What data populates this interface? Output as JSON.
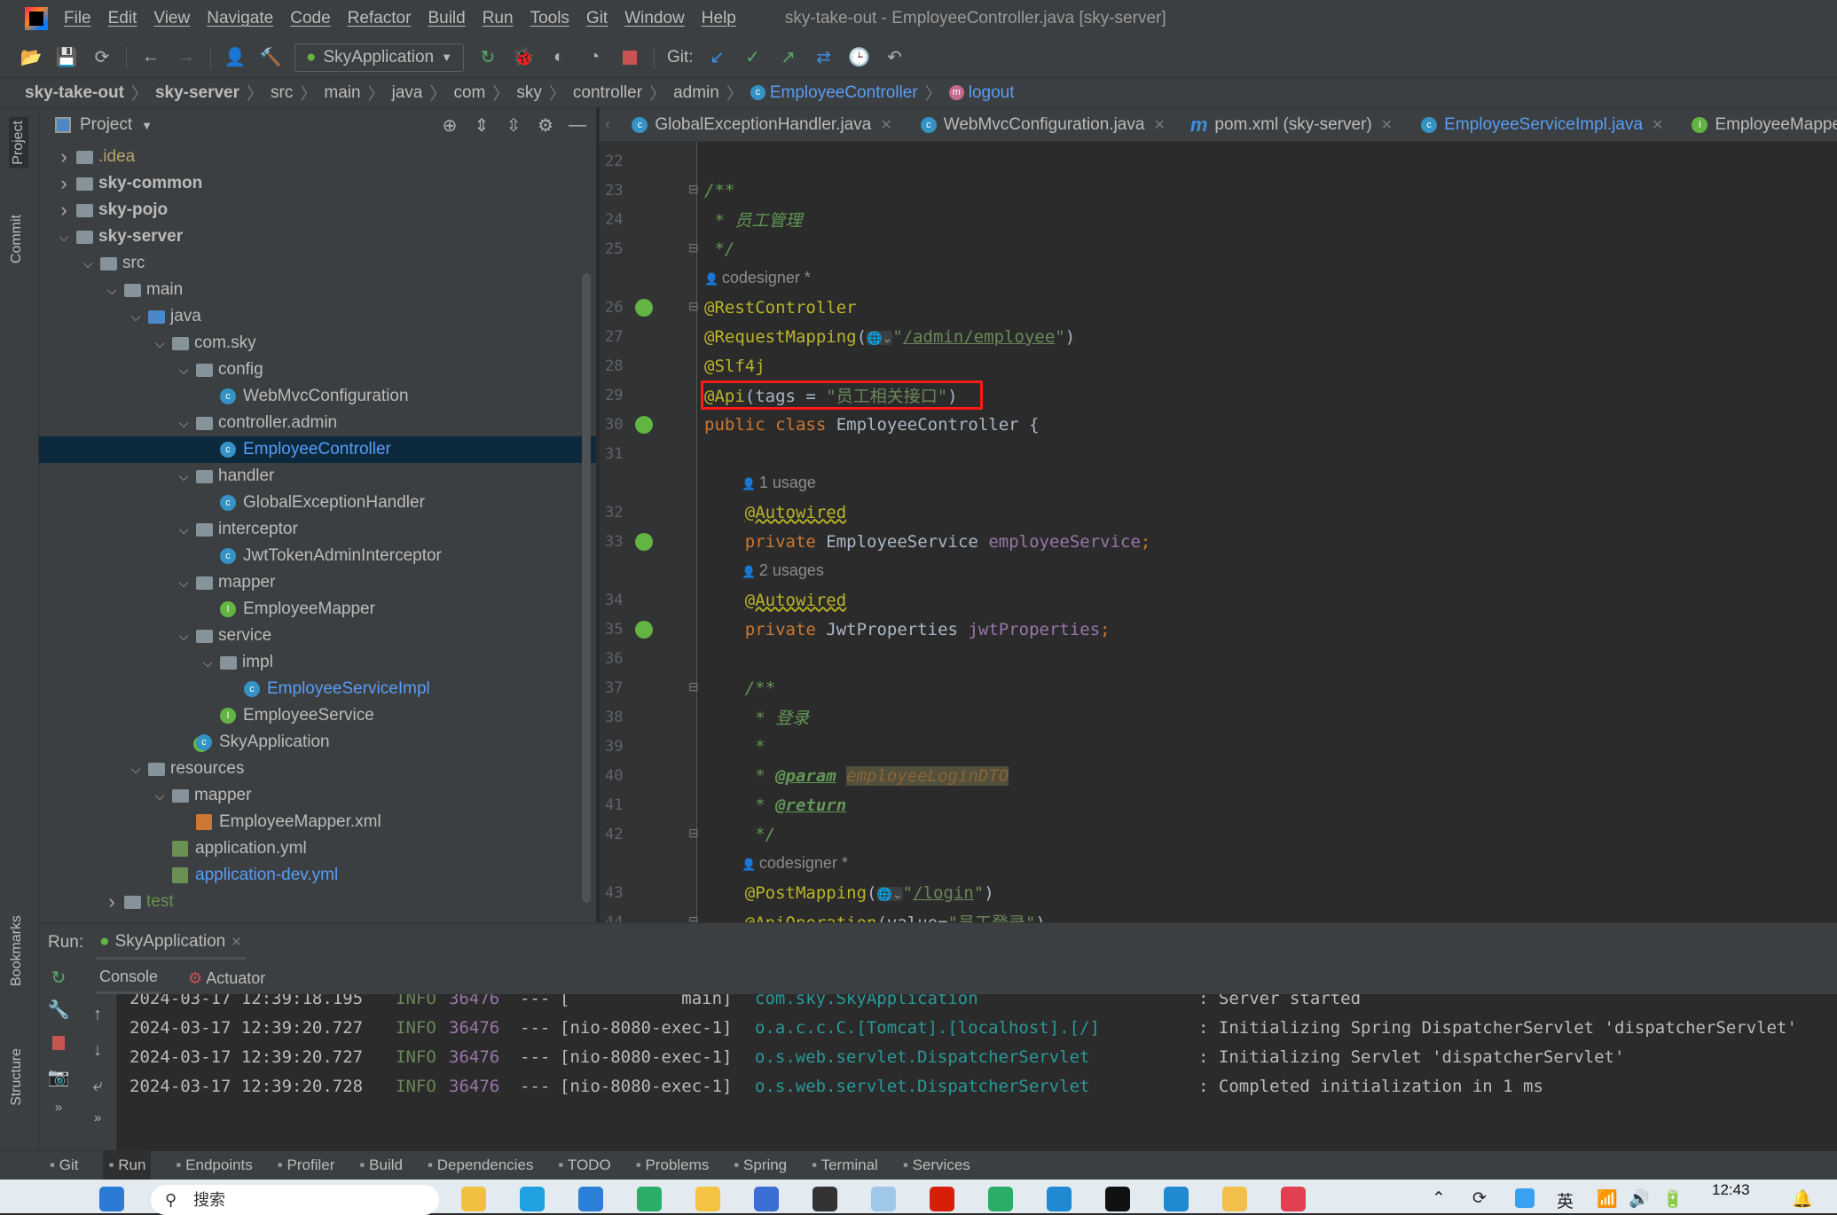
{
  "menu": [
    "File",
    "Edit",
    "View",
    "Navigate",
    "Code",
    "Refactor",
    "Build",
    "Run",
    "Tools",
    "Git",
    "Window",
    "Help"
  ],
  "window_title": "sky-take-out - EmployeeController.java [sky-server]",
  "toolbar": {
    "run_config": "SkyApplication",
    "git_label": "Git:"
  },
  "breadcrumb": [
    {
      "label": "sky-take-out",
      "bold": true
    },
    {
      "label": "sky-server",
      "bold": true
    },
    {
      "label": "src"
    },
    {
      "label": "main"
    },
    {
      "label": "java"
    },
    {
      "label": "com"
    },
    {
      "label": "sky"
    },
    {
      "label": "controller"
    },
    {
      "label": "admin"
    },
    {
      "label": "EmployeeController",
      "icon": "class"
    },
    {
      "label": "logout",
      "icon": "method"
    }
  ],
  "left_strip": {
    "project": "Project",
    "commit": "Commit",
    "bookmarks": "Bookmarks",
    "structure": "Structure"
  },
  "project_panel": {
    "title": "Project",
    "tree": [
      {
        "level": 0,
        "label": ".idea",
        "type": "folder",
        "state": "collapsed",
        "color": "#b8a36a"
      },
      {
        "level": 0,
        "label": "sky-common",
        "type": "module",
        "state": "collapsed",
        "bold": true
      },
      {
        "level": 0,
        "label": "sky-pojo",
        "type": "module",
        "state": "collapsed",
        "bold": true
      },
      {
        "level": 0,
        "label": "sky-server",
        "type": "module",
        "state": "expanded",
        "bold": true
      },
      {
        "level": 1,
        "label": "src",
        "type": "folder",
        "state": "expanded"
      },
      {
        "level": 2,
        "label": "main",
        "type": "folder",
        "state": "expanded"
      },
      {
        "level": 3,
        "label": "java",
        "type": "source",
        "state": "expanded"
      },
      {
        "level": 4,
        "label": "com.sky",
        "type": "package",
        "state": "expanded"
      },
      {
        "level": 5,
        "label": "config",
        "type": "package",
        "state": "expanded"
      },
      {
        "level": 6,
        "label": "WebMvcConfiguration",
        "type": "class"
      },
      {
        "level": 5,
        "label": "controller.admin",
        "type": "package",
        "state": "expanded"
      },
      {
        "level": 6,
        "label": "EmployeeController",
        "type": "class",
        "selected": true,
        "color": "#589df6"
      },
      {
        "level": 5,
        "label": "handler",
        "type": "package",
        "state": "expanded"
      },
      {
        "level": 6,
        "label": "GlobalExceptionHandler",
        "type": "class"
      },
      {
        "level": 5,
        "label": "interceptor",
        "type": "package",
        "state": "expanded"
      },
      {
        "level": 6,
        "label": "JwtTokenAdminInterceptor",
        "type": "class"
      },
      {
        "level": 5,
        "label": "mapper",
        "type": "package",
        "state": "expanded"
      },
      {
        "level": 6,
        "label": "EmployeeMapper",
        "type": "interface"
      },
      {
        "level": 5,
        "label": "service",
        "type": "package",
        "state": "expanded"
      },
      {
        "level": 6,
        "label": "impl",
        "type": "package",
        "state": "expanded"
      },
      {
        "level": 7,
        "label": "EmployeeServiceImpl",
        "type": "class",
        "color": "#589df6"
      },
      {
        "level": 6,
        "label": "EmployeeService",
        "type": "interface"
      },
      {
        "level": 5,
        "label": "SkyApplication",
        "type": "app"
      },
      {
        "level": 3,
        "label": "resources",
        "type": "resources",
        "state": "expanded"
      },
      {
        "level": 4,
        "label": "mapper",
        "type": "folder",
        "state": "expanded"
      },
      {
        "level": 5,
        "label": "EmployeeMapper.xml",
        "type": "xml"
      },
      {
        "level": 4,
        "label": "application.yml",
        "type": "yml"
      },
      {
        "level": 4,
        "label": "application-dev.yml",
        "type": "yml",
        "color": "#589df6"
      },
      {
        "level": 2,
        "label": "test",
        "type": "folder",
        "state": "collapsed",
        "color": "#6a9153"
      }
    ]
  },
  "editor_tabs": [
    {
      "label": "GlobalExceptionHandler.java",
      "icon": "class"
    },
    {
      "label": "WebMvcConfiguration.java",
      "icon": "class"
    },
    {
      "label": "pom.xml (sky-server)",
      "icon": "maven"
    },
    {
      "label": "EmployeeServiceImpl.java",
      "icon": "class",
      "color": "#589df6"
    },
    {
      "label": "EmployeeMapper",
      "icon": "interface"
    }
  ],
  "code": [
    {
      "n": "22",
      "t": []
    },
    {
      "n": "23",
      "t": [
        [
          "cmt",
          "/**"
        ]
      ]
    },
    {
      "n": "24",
      "t": [
        [
          "cmt",
          " * 员工管理"
        ]
      ]
    },
    {
      "n": "25",
      "t": [
        [
          "cmt",
          " */"
        ]
      ]
    },
    {
      "hint": "codesigner *",
      "author": true
    },
    {
      "n": "26",
      "g": "bean",
      "t": [
        [
          "ann",
          "@RestController"
        ]
      ]
    },
    {
      "n": "27",
      "t": [
        [
          "ann",
          "@RequestMapping"
        ],
        [
          "txt",
          "("
        ],
        [
          "hint",
          "🌐⌄"
        ],
        [
          "str",
          "\""
        ],
        [
          "str ul",
          "/admin/employee"
        ],
        [
          "str",
          "\""
        ],
        [
          "txt",
          ")"
        ]
      ]
    },
    {
      "n": "28",
      "t": [
        [
          "ann",
          "@Slf4j"
        ]
      ]
    },
    {
      "n": "29",
      "t": [
        [
          "ann",
          "@Api"
        ],
        [
          "txt",
          "(tags = "
        ],
        [
          "str",
          "\"员工相关接口\""
        ],
        [
          "txt",
          ")"
        ]
      ],
      "highlighted": true
    },
    {
      "n": "30",
      "g": "bean",
      "t": [
        [
          "kw",
          "public class "
        ],
        [
          "txt",
          "EmployeeController {"
        ]
      ]
    },
    {
      "n": "31",
      "t": []
    },
    {
      "hint": "1 usage",
      "indent": true
    },
    {
      "n": "32",
      "t": [
        [
          "txt",
          "    "
        ],
        [
          "ann wavy",
          "@Autowired"
        ]
      ]
    },
    {
      "n": "33",
      "g": "bean",
      "t": [
        [
          "txt",
          "    "
        ],
        [
          "kw",
          "private "
        ],
        [
          "txt",
          "EmployeeService "
        ],
        [
          "fld",
          "employeeService"
        ],
        [
          "kw",
          ";"
        ]
      ]
    },
    {
      "hint": "2 usages",
      "indent": true
    },
    {
      "n": "34",
      "t": [
        [
          "txt",
          "    "
        ],
        [
          "ann wavy",
          "@Autowired"
        ]
      ]
    },
    {
      "n": "35",
      "g": "bean",
      "t": [
        [
          "txt",
          "    "
        ],
        [
          "kw",
          "private "
        ],
        [
          "txt",
          "JwtProperties "
        ],
        [
          "fld",
          "jwtProperties"
        ],
        [
          "kw",
          ";"
        ]
      ]
    },
    {
      "n": "36",
      "t": []
    },
    {
      "n": "37",
      "t": [
        [
          "cmt",
          "    /**"
        ]
      ]
    },
    {
      "n": "38",
      "t": [
        [
          "cmt",
          "     * 登录"
        ]
      ]
    },
    {
      "n": "39",
      "t": [
        [
          "cmt",
          "     *"
        ]
      ]
    },
    {
      "n": "40",
      "t": [
        [
          "cmt",
          "     * "
        ],
        [
          "dtag",
          "@param"
        ],
        [
          "cmt",
          " "
        ],
        [
          "dparam",
          "employeeLoginDTO"
        ]
      ]
    },
    {
      "n": "41",
      "t": [
        [
          "cmt",
          "     * "
        ],
        [
          "dtag",
          "@return"
        ]
      ]
    },
    {
      "n": "42",
      "t": [
        [
          "cmt",
          "     */"
        ]
      ]
    },
    {
      "hint": "codesigner *",
      "author": true,
      "indent": true
    },
    {
      "n": "43",
      "t": [
        [
          "txt",
          "    "
        ],
        [
          "ann",
          "@PostMapping"
        ],
        [
          "txt",
          "("
        ],
        [
          "hint",
          "🌐⌄"
        ],
        [
          "str",
          "\""
        ],
        [
          "str ul",
          "/login"
        ],
        [
          "str",
          "\""
        ],
        [
          "txt",
          ")"
        ]
      ]
    },
    {
      "n": "44",
      "t": [
        [
          "txt",
          "    "
        ],
        [
          "ann",
          "@ApiOperation"
        ],
        [
          "txt",
          "(value="
        ],
        [
          "str",
          "\"员工登录\""
        ],
        [
          "txt",
          ")"
        ]
      ]
    }
  ],
  "run_panel": {
    "label": "Run:",
    "config": "SkyApplication",
    "tabs": [
      "Console",
      "Actuator"
    ],
    "log": [
      {
        "ts": "2024-03-17 12:39:18.195",
        "level": "INFO",
        "pid": "36476",
        "sep": "---",
        "thread": "[           main]",
        "logger": "com.sky.SkyApplication",
        "msg": ": Server started"
      },
      {
        "ts": "2024-03-17 12:39:20.727",
        "level": "INFO",
        "pid": "36476",
        "sep": "---",
        "thread": "[nio-8080-exec-1]",
        "logger": "o.a.c.c.C.[Tomcat].[localhost].[/]",
        "msg": ": Initializing Spring DispatcherServlet 'dispatcherServlet'"
      },
      {
        "ts": "2024-03-17 12:39:20.727",
        "level": "INFO",
        "pid": "36476",
        "sep": "---",
        "thread": "[nio-8080-exec-1]",
        "logger": "o.s.web.servlet.DispatcherServlet",
        "msg": ": Initializing Servlet 'dispatcherServlet'"
      },
      {
        "ts": "2024-03-17 12:39:20.728",
        "level": "INFO",
        "pid": "36476",
        "sep": "---",
        "thread": "[nio-8080-exec-1]",
        "logger": "o.s.web.servlet.DispatcherServlet",
        "msg": ": Completed initialization in 1 ms"
      }
    ]
  },
  "bottom_tools": [
    {
      "label": "Git",
      "icon": "git-icon"
    },
    {
      "label": "Run",
      "icon": "run-icon",
      "active": true
    },
    {
      "label": "Endpoints",
      "icon": "endpoints-icon"
    },
    {
      "label": "Profiler",
      "icon": "profiler-icon"
    },
    {
      "label": "Build",
      "icon": "build-icon"
    },
    {
      "label": "Dependencies",
      "icon": "dependencies-icon"
    },
    {
      "label": "TODO",
      "icon": "todo-icon"
    },
    {
      "label": "Problems",
      "icon": "problems-icon"
    },
    {
      "label": "Spring",
      "icon": "spring-icon"
    },
    {
      "label": "Terminal",
      "icon": "terminal-icon"
    },
    {
      "label": "Services",
      "icon": "services-icon"
    }
  ],
  "taskbar": {
    "search_placeholder": "搜索",
    "ime": "英",
    "time": "12:43",
    "apps": [
      {
        "name": "file-explorer",
        "color": "#f0c040"
      },
      {
        "name": "edge",
        "color": "#1fa0e0"
      },
      {
        "name": "edge-beta",
        "color": "#2b7fd6"
      },
      {
        "name": "wechat-work",
        "color": "#2aae67"
      },
      {
        "name": "folder",
        "color": "#f5c342"
      },
      {
        "name": "store",
        "color": "#3b6fd4"
      },
      {
        "name": "app",
        "color": "#333"
      },
      {
        "name": "feishu",
        "color": "#9fc7e8"
      },
      {
        "name": "netease-music",
        "color": "#d81e06"
      },
      {
        "name": "wechat",
        "color": "#2aae67"
      },
      {
        "name": "vscode",
        "color": "#1f8ad2"
      },
      {
        "name": "intellij",
        "color": "#111"
      },
      {
        "name": "edge-dev",
        "color": "#1f8ad2"
      },
      {
        "name": "app2",
        "color": "#f2c04a"
      },
      {
        "name": "app3",
        "color": "#e04050"
      }
    ]
  }
}
